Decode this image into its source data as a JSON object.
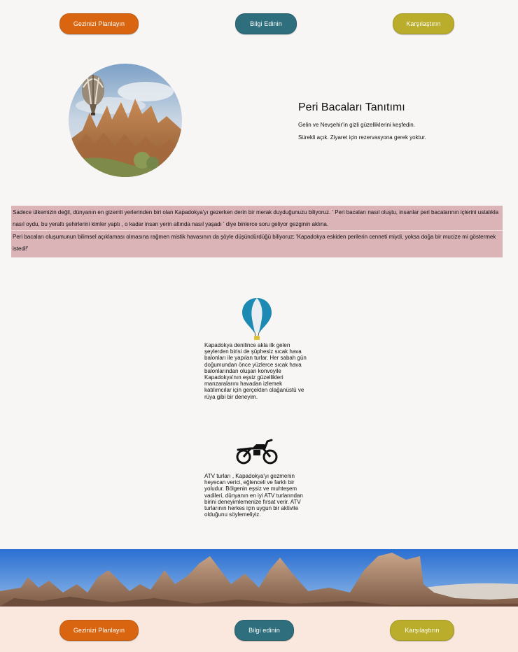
{
  "header": {
    "plan_label": "Gezinizi Planlayın",
    "info_label": "Bilgi Edinin",
    "compare_label": "Karşılaştırın"
  },
  "hero": {
    "title": "Peri Bacaları Tanıtımı",
    "line1": "Gelin ve Nevşehir'in gizli güzelliklerini keşfedin.",
    "line2": "Sürekli açık. Ziyaret için rezervasyona gerek yoktur."
  },
  "intro": {
    "paragraph1": "Sadece ülkemizin değil, dünyanın en gizemli yerlerinden biri olan Kapadokya'yı gezerken derin bir merak duyduğunuzu biliyoruz. ' Peri bacaları nasıl oluştu, insanlar peri bacalarının içlerini ustalıkla nasıl oydu, bu yeraltı şehirlerini kimler yaptı , o kadar insan yerin altında nasıl yaşadı ' diye binlerce soru geliyor gezginin aklına.",
    "paragraph2": "Peri bacaları oluşumunun bilimsel açıklaması olmasına rağmen mistik havasının da şöyle düşündürdüğü biliyoruz; 'Kapadokya eskiden perilerin cenneti miydi, yoksa doğa bir mucize mi göstermek istedi!'"
  },
  "features": [
    {
      "icon": "hot-air-balloon-icon",
      "text": "Kapadokya denilince akla ilk gelen şeylerden birisi de şüphesiz sıcak hava balonları ile yapılan turlar. Her sabah gün doğumundan önce yüzlerce sıcak hava balonlarından oluşan konvoyile Kapadokya'nın eşsiz güzellikleri manzaralarını havadan izlemek katılımcılar için gerçekten olağanüstü ve rüya gibi bir deneyim."
    },
    {
      "icon": "atv-icon",
      "text": "ATV turları , Kapadokya'yı gezmenin heyecan verici, eğlenceli ve farklı bir yoludur. Bölgenin eşsiz ve muhteşem vadileri, dünyanın en iyi ATV turlarından birini deneyimlemenize fırsat verir. ATV turlarının herkes için uygun bir aktivite olduğunu söylemeliyiz."
    }
  ],
  "footer": {
    "plan_label": "Gezinizi Planlayın",
    "info_label": "Bilgi edinin",
    "compare_label": "Karşılaştırın"
  },
  "colors": {
    "orange": "#d96510",
    "teal": "#2f6e7c",
    "olive": "#b9ad2b",
    "intro_bg": "#dbb4b8",
    "footer_bg": "#fae8de",
    "balloon_icon": "#1d8ab3"
  }
}
